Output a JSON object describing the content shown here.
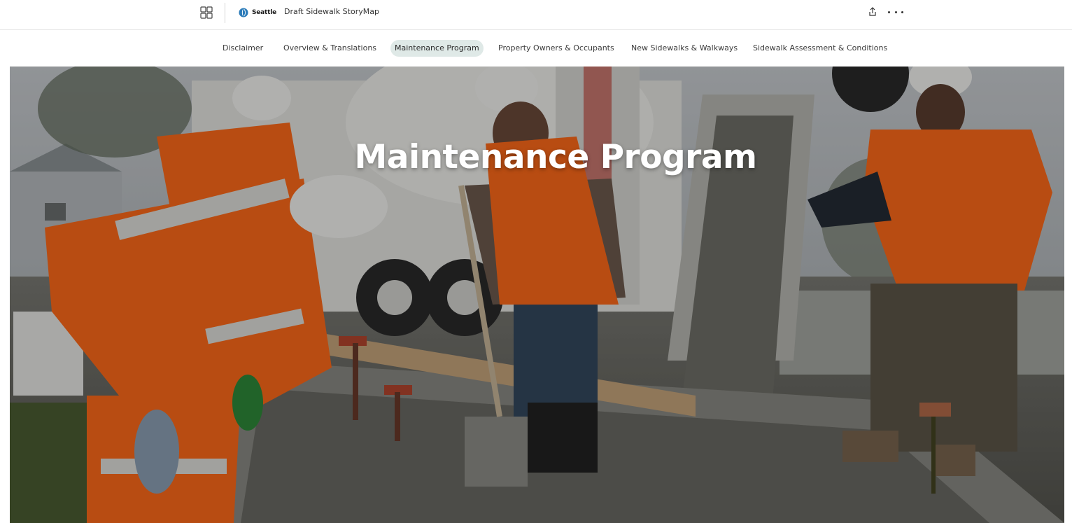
{
  "header": {
    "logo_text": "Seattle",
    "story_title": "Draft Sidewalk StoryMap",
    "icons": [
      "apps-grid-icon",
      "seattle-logo-icon",
      "share-icon",
      "more-options-icon"
    ]
  },
  "nav": {
    "items": [
      {
        "label": "Disclaimer",
        "active": false
      },
      {
        "label": "Overview & Translations",
        "active": false
      },
      {
        "label": "Maintenance Program",
        "active": true
      },
      {
        "label": "Property Owners & Occupants",
        "active": false
      },
      {
        "label": "New Sidewalks & Walkways",
        "active": false
      },
      {
        "label": "Sidewalk Assessment & Conditions",
        "active": false
      }
    ]
  },
  "hero": {
    "title": "Maintenance Program"
  },
  "colors": {
    "active_tab_bg": "#dfe9e7",
    "hero_text": "#ffffff",
    "safety_orange": "#ff6a1a",
    "concrete": "#8a8a84"
  }
}
